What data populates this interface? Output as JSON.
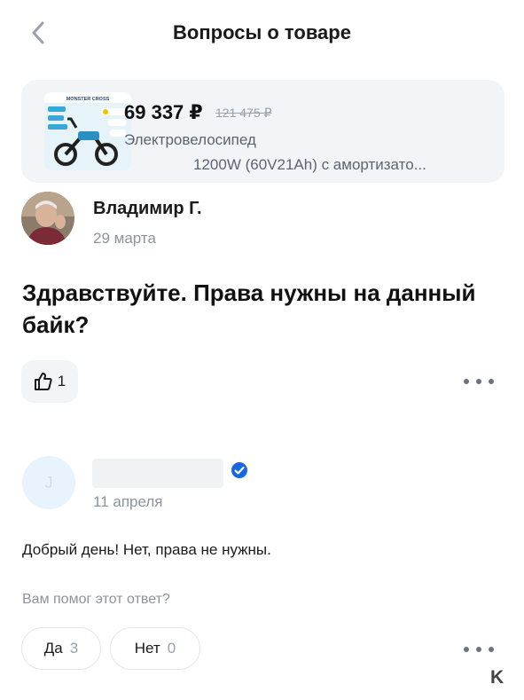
{
  "header": {
    "title": "Вопросы о товаре",
    "back_icon": "chevron-left-icon"
  },
  "product": {
    "price": "69 337 ₽",
    "old_price": "121 475 ₽",
    "name_line1": "Электровелосипед",
    "name_line2": "1200W (60V21Ah) с амортизато...",
    "thumbnail_brand": "MONSTER CROSS"
  },
  "question": {
    "author": "Владимир Г.",
    "date": "29 марта",
    "text": "Здравствуйте. Права нужны на данный байк?",
    "likes": "1"
  },
  "answer": {
    "avatar_letter": "J",
    "date": "11 апреля",
    "text": "Добрый день! Нет, права не нужны.",
    "helpful_prompt": "Вам помог этот ответ?",
    "yes_label": "Да",
    "yes_count": "3",
    "no_label": "Нет",
    "no_count": "0"
  },
  "colors": {
    "accent": "#1a66e0",
    "card_bg": "#f2f4f8",
    "muted_text": "#8c939d"
  }
}
